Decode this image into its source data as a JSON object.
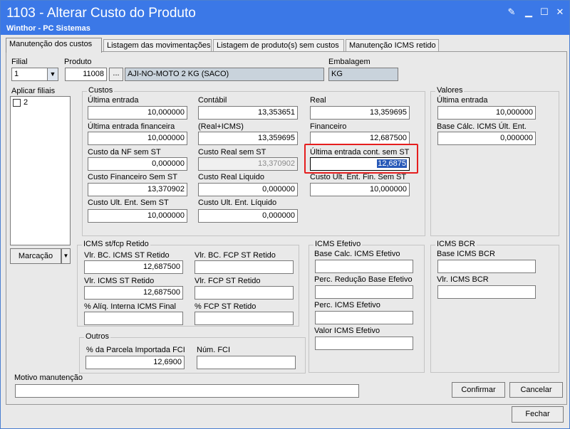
{
  "window": {
    "title": "1103 - Alterar Custo do Produto",
    "subtitle": "Winthor - PC Sistemas"
  },
  "tabs": [
    {
      "label": "Manutenção dos custos"
    },
    {
      "label": "Listagem das movimentações"
    },
    {
      "label": "Listagem de produto(s)  sem custos"
    },
    {
      "label": "Manutenção ICMS retido"
    }
  ],
  "header": {
    "filial_label": "Filial",
    "filial_value": "1",
    "produto_label": "Produto",
    "produto_code": "11008",
    "produto_browse": "...",
    "produto_desc": "AJI-NO-MOTO 2 KG (SACO)",
    "embalagem_label": "Embalagem",
    "embalagem_value": "KG"
  },
  "aplicar_filiais": {
    "label": "Aplicar filiais",
    "items": [
      {
        "label": "2",
        "checked": false
      }
    ],
    "marcacao": "Marcação"
  },
  "custos": {
    "title": "Custos",
    "ultima_entrada": {
      "label": "Última entrada",
      "value": "10,000000"
    },
    "contabil": {
      "label": "Contábil",
      "value": "13,353651"
    },
    "real": {
      "label": "Real",
      "value": "13,359695"
    },
    "ultima_entrada_fin": {
      "label": "Última entrada financeira",
      "value": "10,000000"
    },
    "real_icms": {
      "label": "(Real+ICMS)",
      "value": "13,359695"
    },
    "financeiro": {
      "label": "Financeiro",
      "value": "12,687500"
    },
    "custo_nf_sem_st": {
      "label": "Custo da NF sem ST",
      "value": "0,000000"
    },
    "custo_real_sem_st": {
      "label": "Custo Real sem ST",
      "value": "13,370902"
    },
    "ultima_entrada_cont_sem_st": {
      "label": "Última entrada cont. sem ST",
      "value": "12,6875"
    },
    "custo_fin_sem_st": {
      "label": "Custo Financeiro Sem ST",
      "value": "13,370902"
    },
    "custo_real_liquido": {
      "label": "Custo Real Liquido",
      "value": "0,000000"
    },
    "custo_ult_ent_fin_sem_st": {
      "label": "Custo Ult. Ent. Fin. Sem ST",
      "value": "10,000000"
    },
    "custo_ult_ent_sem_st": {
      "label": "Custo Ult. Ent. Sem ST",
      "value": "10,000000"
    },
    "custo_ult_ent_liquido": {
      "label": "Custo Ult. Ent. Líquido",
      "value": "0,000000"
    }
  },
  "valores": {
    "title": "Valores",
    "ultima_entrada": {
      "label": "Última entrada",
      "value": "10,000000"
    },
    "base_calc_icms": {
      "label": "Base Cálc. ICMS Últ. Ent.",
      "value": "0,000000"
    }
  },
  "icms_st": {
    "title": "ICMS st/fcp Retido",
    "vlr_bc_icms_st": {
      "label": "Vlr. BC. ICMS ST Retido",
      "value": "12,687500"
    },
    "vlr_bc_fcp_st": {
      "label": "Vlr. BC. FCP ST Retido",
      "value": ""
    },
    "vlr_icms_st": {
      "label": "Vlr. ICMS ST Retido",
      "value": "12,687500"
    },
    "vlr_fcp_st": {
      "label": "Vlr. FCP ST Retido",
      "value": ""
    },
    "aliq_interna": {
      "label": "% Alíq. Interna ICMS Final",
      "value": ""
    },
    "fcp_st": {
      "label": "% FCP ST Retido",
      "value": ""
    }
  },
  "icms_efetivo": {
    "title": "ICMS Efetivo",
    "base_calc": {
      "label": "Base Calc. ICMS Efetivo",
      "value": ""
    },
    "perc_reducao": {
      "label": "Perc. Redução Base Efetivo",
      "value": ""
    },
    "perc_icms": {
      "label": "Perc. ICMS Efetivo",
      "value": ""
    },
    "valor_icms": {
      "label": "Valor ICMS Efetivo",
      "value": ""
    }
  },
  "icms_bcr": {
    "title": "ICMS BCR",
    "base": {
      "label": "Base ICMS BCR",
      "value": ""
    },
    "vlr": {
      "label": "Vlr. ICMS BCR",
      "value": ""
    }
  },
  "outros": {
    "title": "Outros",
    "parcela_fci": {
      "label": "% da Parcela Importada FCI",
      "value": "12,6900"
    },
    "num_fci": {
      "label": "Núm. FCI",
      "value": ""
    }
  },
  "motivo": {
    "label": "Motivo manutenção",
    "value": ""
  },
  "buttons": {
    "confirmar": "Confirmar",
    "cancelar": "Cancelar",
    "fechar": "Fechar"
  }
}
